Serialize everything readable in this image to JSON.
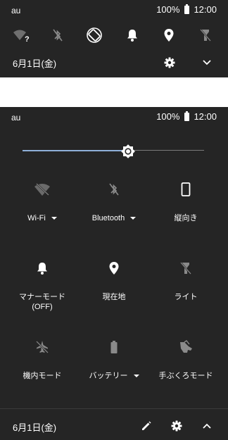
{
  "status": {
    "carrier": "au",
    "battery": "100%",
    "time": "12:00"
  },
  "collapsed": {
    "quick_icons": [
      "wifi-unknown-icon",
      "bluetooth-off-icon",
      "auto-rotate-icon",
      "bell-icon",
      "location-pin-icon",
      "flashlight-off-icon"
    ],
    "date": "6月1日(金)",
    "settings_icon": "gear-icon",
    "expand_icon": "chevron-down-icon"
  },
  "expanded": {
    "brightness": {
      "level": 0.58,
      "icon": "brightness-icon"
    },
    "tiles": [
      {
        "label": "Wi-Fi",
        "icon": "wifi-off-icon",
        "dropdown": true,
        "active": false
      },
      {
        "label": "Bluetooth",
        "icon": "bluetooth-off-icon",
        "dropdown": true,
        "active": false
      },
      {
        "label": "縦向き",
        "icon": "portrait-phone-icon",
        "dropdown": false,
        "active": true
      },
      {
        "label": "マナーモード\n(OFF)",
        "icon": "bell-icon",
        "dropdown": false,
        "active": true
      },
      {
        "label": "現在地",
        "icon": "location-pin-icon",
        "dropdown": false,
        "active": true
      },
      {
        "label": "ライト",
        "icon": "flashlight-off-icon",
        "dropdown": false,
        "active": false
      },
      {
        "label": "機内モード",
        "icon": "airplane-off-icon",
        "dropdown": false,
        "active": false
      },
      {
        "label": "バッテリー",
        "icon": "battery-icon",
        "dropdown": true,
        "active": false
      },
      {
        "label": "手ぶくろモード",
        "icon": "glove-icon",
        "dropdown": false,
        "active": false
      }
    ],
    "date": "6月1日(金)",
    "edit_icon": "pencil-icon",
    "settings_icon": "gear-icon",
    "collapse_icon": "chevron-up-icon"
  },
  "colors": {
    "panel": "#252525",
    "brightness_fill": "#8fb0d9",
    "inactive_icon": "#8a8a8a"
  }
}
